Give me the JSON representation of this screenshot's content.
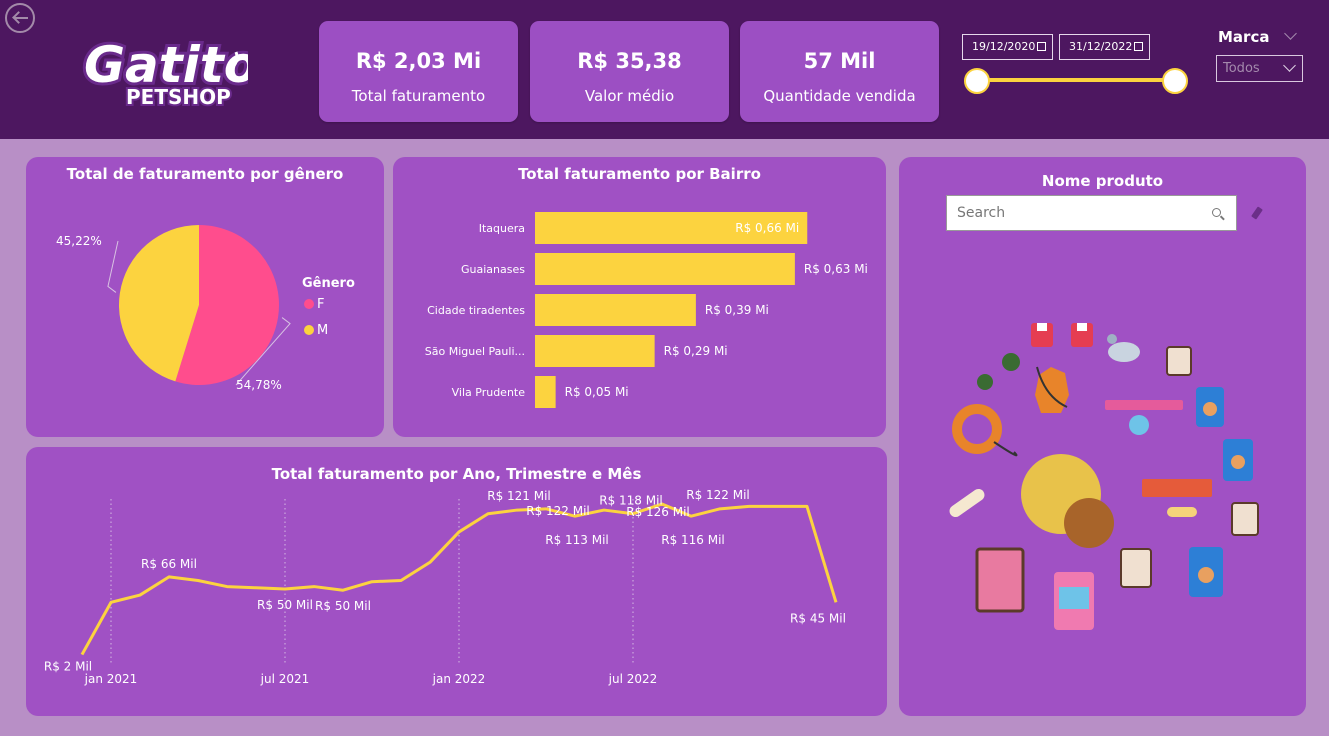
{
  "logo": {
    "line1": "Gatito",
    "line2": "PETSHOP"
  },
  "kpis": [
    {
      "value": "R$ 2,03 Mi",
      "label": "Total faturamento"
    },
    {
      "value": "R$ 35,38",
      "label": "Valor médio"
    },
    {
      "value": "57 Mil",
      "label": "Quantidade vendida"
    }
  ],
  "date_filter": {
    "start": "19/12/2020",
    "end": "31/12/2022"
  },
  "marca": {
    "title": "Marca",
    "selected": "Todos"
  },
  "gender_panel": {
    "title": "Total de faturamento por gênero"
  },
  "bairro_panel": {
    "title": "Total faturamento por Bairro"
  },
  "timeline_panel": {
    "title": "Total faturamento por Ano, Trimestre e Mês"
  },
  "product_panel": {
    "title": "Nome produto",
    "search_placeholder": "Search"
  },
  "colors": {
    "header": "#4d1760",
    "panel": "#a051c4",
    "kpi": "#9c4fc3",
    "yellow": "#fcd33f",
    "pink": "#ff4d8d"
  },
  "chart_data": [
    {
      "type": "pie",
      "legend_title": "Gênero",
      "slices": [
        {
          "name": "F",
          "value": 54.78,
          "label": "54,78%",
          "color": "#ff4d8d"
        },
        {
          "name": "M",
          "value": 45.22,
          "label": "45,22%",
          "color": "#fcd33f"
        }
      ],
      "legend_placement": "right"
    },
    {
      "type": "bar",
      "orientation": "horizontal",
      "categories": [
        "Itaquera",
        "Guaianases",
        "Cidade tiradentes",
        "São Miguel Pauli...",
        "Vila Prudente"
      ],
      "values": [
        0.66,
        0.63,
        0.39,
        0.29,
        0.05
      ],
      "labels": [
        "R$ 0,66 Mi",
        "R$ 0,63 Mi",
        "R$ 0,39 Mi",
        "R$ 0,29 Mi",
        "R$ 0,05 Mi"
      ],
      "xlim": [
        0,
        0.8
      ],
      "color": "#fcd33f"
    },
    {
      "type": "line",
      "x_ticks": [
        "jan 2021",
        "jul 2021",
        "jan 2022",
        "jul 2022"
      ],
      "values": [
        2,
        45,
        51,
        66,
        63,
        58,
        57,
        56,
        58,
        55,
        62,
        63,
        78,
        103,
        118,
        121,
        122,
        116,
        121,
        118,
        126,
        116,
        122,
        124,
        124,
        124,
        45
      ],
      "point_labels": [
        {
          "index": 0,
          "text": "R$ 2 Mil"
        },
        {
          "index": 3,
          "text": "R$ 66 Mil"
        },
        {
          "index": 7,
          "text": "R$ 50 Mil"
        },
        {
          "index": 9,
          "text": "R$ 50 Mil"
        },
        {
          "index": 15,
          "text": "R$ 121 Mil"
        },
        {
          "index": 16,
          "text": "R$ 122 Mil"
        },
        {
          "index": 17,
          "text": "R$ 113 Mil"
        },
        {
          "index": 19,
          "text": "R$ 118 Mil"
        },
        {
          "index": 20,
          "text": "R$ 126 Mil"
        },
        {
          "index": 21,
          "text": "R$ 116 Mil"
        },
        {
          "index": 22,
          "text": "R$ 122 Mil"
        },
        {
          "index": 26,
          "text": "R$ 45 Mil"
        }
      ],
      "ylim": [
        0,
        140
      ],
      "color": "#fcd33f",
      "grid": "vertical-dotted"
    }
  ]
}
